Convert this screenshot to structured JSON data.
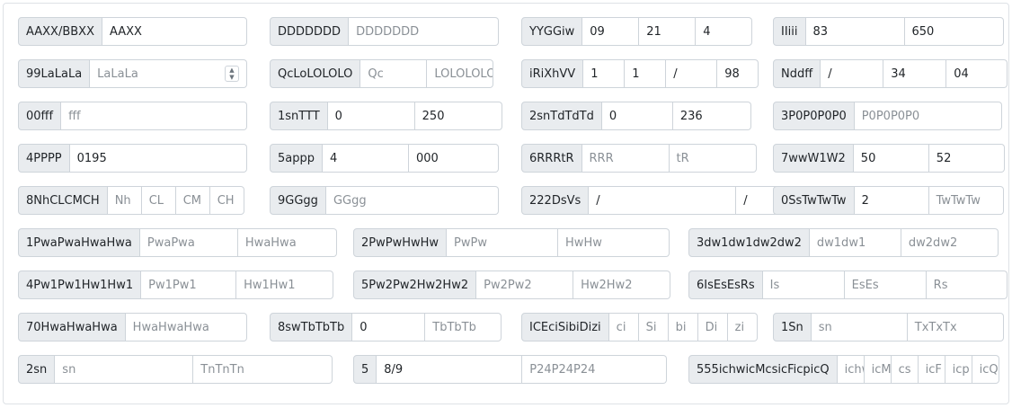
{
  "rows": [
    [
      {
        "label": "AAXX/BBXX",
        "fields": [
          {
            "text": "AAXX",
            "ph": false
          }
        ]
      },
      {
        "label": "DDDDDDD",
        "fields": [
          {
            "text": "DDDDDDD",
            "ph": true
          }
        ]
      },
      {
        "label": "YYGGiw",
        "fields": [
          {
            "text": "09",
            "ph": false
          },
          {
            "text": "21",
            "ph": false
          },
          {
            "text": "4",
            "ph": false
          }
        ]
      },
      {
        "label": "IIiii",
        "fields": [
          {
            "text": "83",
            "ph": false
          },
          {
            "text": "650",
            "ph": false
          }
        ]
      }
    ],
    [
      {
        "label": "99LaLaLa",
        "fields": [
          {
            "text": "LaLaLa",
            "ph": true,
            "spin": true
          }
        ]
      },
      {
        "label": "QcLoLOLOLO",
        "fields": [
          {
            "text": "Qc",
            "ph": true
          },
          {
            "text": "LOLOLOLO",
            "ph": true
          }
        ]
      },
      {
        "label": "iRiXhVV",
        "fields": [
          {
            "text": "1",
            "ph": false
          },
          {
            "text": "1",
            "ph": false
          },
          {
            "text": "/",
            "ph": false
          },
          {
            "text": "98",
            "ph": false
          }
        ]
      },
      {
        "label": "Nddff",
        "fields": [
          {
            "text": "/",
            "ph": false
          },
          {
            "text": "34",
            "ph": false
          },
          {
            "text": "04",
            "ph": false
          }
        ]
      }
    ],
    [
      {
        "label": "00fff",
        "fields": [
          {
            "text": "fff",
            "ph": true
          }
        ]
      },
      {
        "label": "1snTTT",
        "fields": [
          {
            "text": "0",
            "ph": false
          },
          {
            "text": "250",
            "ph": false
          }
        ]
      },
      {
        "label": "2snTdTdTd",
        "fields": [
          {
            "text": "0",
            "ph": false
          },
          {
            "text": "236",
            "ph": false
          }
        ]
      },
      {
        "label": "3P0P0P0P0",
        "fields": [
          {
            "text": "P0P0P0P0",
            "ph": true
          }
        ]
      }
    ],
    [
      {
        "label": "4PPPP",
        "fields": [
          {
            "text": "0195",
            "ph": false
          }
        ]
      },
      {
        "label": "5appp",
        "fields": [
          {
            "text": "4",
            "ph": false
          },
          {
            "text": "000",
            "ph": false
          }
        ]
      },
      {
        "label": "6RRRtR",
        "fields": [
          {
            "text": "RRR",
            "ph": true
          },
          {
            "text": "tR",
            "ph": true
          }
        ]
      },
      {
        "label": "7wwW1W2",
        "fields": [
          {
            "text": "50",
            "ph": false
          },
          {
            "text": "52",
            "ph": false
          }
        ]
      }
    ],
    [
      {
        "label": "8NhCLCMCH",
        "fields": [
          {
            "text": "Nh",
            "ph": true
          },
          {
            "text": "CL",
            "ph": true
          },
          {
            "text": "CM",
            "ph": true
          },
          {
            "text": "CH",
            "ph": true
          }
        ]
      },
      {
        "label": "9GGgg",
        "fields": [
          {
            "text": "GGgg",
            "ph": true
          }
        ]
      },
      {
        "label": "222DsVs",
        "fields": [
          {
            "text": "/",
            "ph": false
          },
          {
            "text": "/",
            "ph": false
          }
        ]
      },
      {
        "label": "0SsTwTwTw",
        "fields": [
          {
            "text": "2",
            "ph": false
          },
          {
            "text": "TwTwTw",
            "ph": true
          }
        ]
      }
    ],
    [
      {
        "label": "1PwaPwaHwaHwa",
        "fields": [
          {
            "text": "PwaPwa",
            "ph": true
          },
          {
            "text": "HwaHwa",
            "ph": true
          }
        ]
      },
      {
        "label": "2PwPwHwHw",
        "fields": [
          {
            "text": "PwPw",
            "ph": true
          },
          {
            "text": "HwHw",
            "ph": true
          }
        ]
      },
      {
        "label": "3dw1dw1dw2dw2",
        "fields": [
          {
            "text": "dw1dw1",
            "ph": true
          },
          {
            "text": "dw2dw2",
            "ph": true
          }
        ]
      }
    ],
    [
      {
        "label": "4Pw1Pw1Hw1Hw1",
        "fields": [
          {
            "text": "Pw1Pw1",
            "ph": true
          },
          {
            "text": "Hw1Hw1",
            "ph": true
          }
        ]
      },
      {
        "label": "5Pw2Pw2Hw2Hw2",
        "fields": [
          {
            "text": "Pw2Pw2",
            "ph": true
          },
          {
            "text": "Hw2Hw2",
            "ph": true
          }
        ]
      },
      {
        "label": "6IsEsEsRs",
        "fields": [
          {
            "text": "Is",
            "ph": true
          },
          {
            "text": "EsEs",
            "ph": true
          },
          {
            "text": "Rs",
            "ph": true
          }
        ]
      }
    ],
    [
      {
        "label": "70HwaHwaHwa",
        "fields": [
          {
            "text": "HwaHwaHwa",
            "ph": true
          }
        ]
      },
      {
        "label": "8swTbTbTb",
        "fields": [
          {
            "text": "0",
            "ph": false
          },
          {
            "text": "TbTbTb",
            "ph": true
          }
        ]
      },
      {
        "label": "ICEciSibiDizi",
        "fields": [
          {
            "text": "ci",
            "ph": true
          },
          {
            "text": "Si",
            "ph": true
          },
          {
            "text": "bi",
            "ph": true
          },
          {
            "text": "Di",
            "ph": true
          },
          {
            "text": "zi",
            "ph": true
          }
        ]
      },
      {
        "label": "1Sn",
        "fields": [
          {
            "text": "sn",
            "ph": true
          },
          {
            "text": "TxTxTx",
            "ph": true
          }
        ]
      }
    ],
    [
      {
        "label": "2sn",
        "fields": [
          {
            "text": "sn",
            "ph": true
          },
          {
            "text": "TnTnTn",
            "ph": true
          }
        ]
      },
      {
        "label": "5",
        "fields": [
          {
            "text": "8/9",
            "ph": false
          },
          {
            "text": "P24P24P24",
            "ph": true
          }
        ]
      },
      {
        "label": "555ichwicMcsicFicpicQ",
        "fields": [
          {
            "text": "ichw",
            "ph": true
          },
          {
            "text": "icM",
            "ph": true
          },
          {
            "text": "cs",
            "ph": true
          },
          {
            "text": "icF",
            "ph": true
          },
          {
            "text": "icp",
            "ph": true
          },
          {
            "text": "icQ",
            "ph": true
          }
        ]
      }
    ]
  ],
  "icons": {
    "spinner": "spinner-icon"
  }
}
